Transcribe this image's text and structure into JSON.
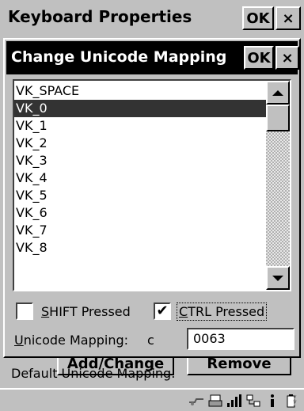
{
  "background_window": {
    "title": "Keyboard Properties",
    "ok_label": "OK",
    "close_label": "×",
    "buttons": [
      "Add/Change",
      "Remove"
    ]
  },
  "dialog": {
    "title": "Change Unicode Mapping",
    "ok_label": "OK",
    "close_label": "×",
    "list_items": [
      "VK_SPACE",
      "VK_0",
      "VK_1",
      "VK_2",
      "VK_3",
      "VK_4",
      "VK_5",
      "VK_6",
      "VK_7",
      "VK_8"
    ],
    "selected_item": "VK_0",
    "shift_label": "SHIFT Pressed",
    "shift_checked": false,
    "ctrl_label": "CTRL Pressed",
    "ctrl_checked": true,
    "unicode_mapping_label": "Unicode Mapping:",
    "unicode_char": "c",
    "unicode_value": "0063",
    "default_mapping_label": "Default Unicode Mapping:"
  },
  "colors": {
    "face": "#c0c0c0",
    "selection": "#333333",
    "title_active": "#000000"
  }
}
